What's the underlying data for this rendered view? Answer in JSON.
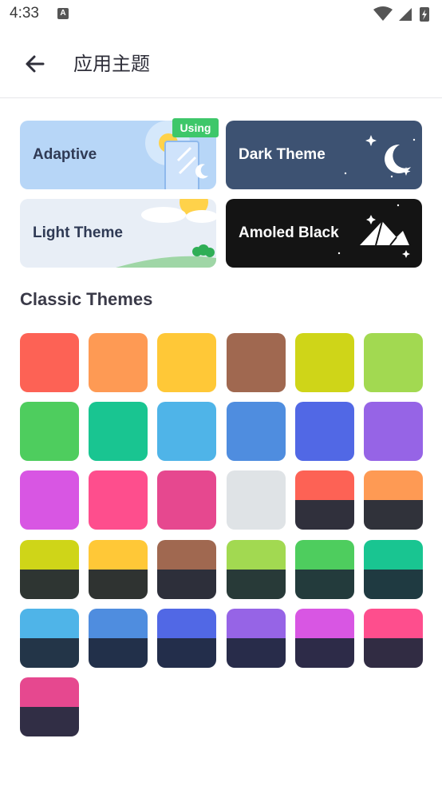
{
  "status": {
    "time": "4:33",
    "app_icon": "A"
  },
  "header": {
    "title": "应用主题",
    "back_icon": "arrow-left-icon"
  },
  "themes": [
    {
      "label": "Adaptive",
      "bg": "#b7d6f7",
      "text_color": "#2f3a55",
      "selected": true
    },
    {
      "label": "Dark Theme",
      "bg": "#3d5272",
      "text_color": "#ffffff",
      "selected": false
    },
    {
      "label": "Light Theme",
      "bg": "#e8eef6",
      "text_color": "#2f3a55",
      "selected": false
    },
    {
      "label": "Amoled Black",
      "bg": "#141414",
      "text_color": "#ffffff",
      "selected": false
    }
  ],
  "badge": {
    "label": "Using"
  },
  "classic": {
    "title": "Classic Themes",
    "solid": [
      "#fd6255",
      "#fe9a54",
      "#ffc837",
      "#a06850",
      "#cfd518",
      "#a2d951",
      "#4ecd5e",
      "#19c591",
      "#4fb4e8",
      "#4f8ddf",
      "#5168e5",
      "#9664e6",
      "#d856e3",
      "#fe4e8d",
      "#e6488f",
      "#dfe3e6"
    ],
    "split": [
      {
        "top": "#fd6255",
        "bottom": "#30303c"
      },
      {
        "top": "#fe9a54",
        "bottom": "#30323a"
      },
      {
        "top": "#cfd518",
        "bottom": "#2e3532"
      },
      {
        "top": "#ffc837",
        "bottom": "#2f3331"
      },
      {
        "top": "#a06850",
        "bottom": "#2d2f3a"
      },
      {
        "top": "#a2d951",
        "bottom": "#283a38"
      },
      {
        "top": "#4ecd5e",
        "bottom": "#233b3c"
      },
      {
        "top": "#19c591",
        "bottom": "#1f3a41"
      },
      {
        "top": "#4fb4e8",
        "bottom": "#233548"
      },
      {
        "top": "#4f8ddf",
        "bottom": "#22304a"
      },
      {
        "top": "#5168e5",
        "bottom": "#232e4b"
      },
      {
        "top": "#9664e6",
        "bottom": "#282c4a"
      },
      {
        "top": "#d856e3",
        "bottom": "#2d2b48"
      },
      {
        "top": "#fe4e8d",
        "bottom": "#312c43"
      },
      {
        "top": "#e6488f",
        "bottom": "#312e45"
      }
    ]
  }
}
